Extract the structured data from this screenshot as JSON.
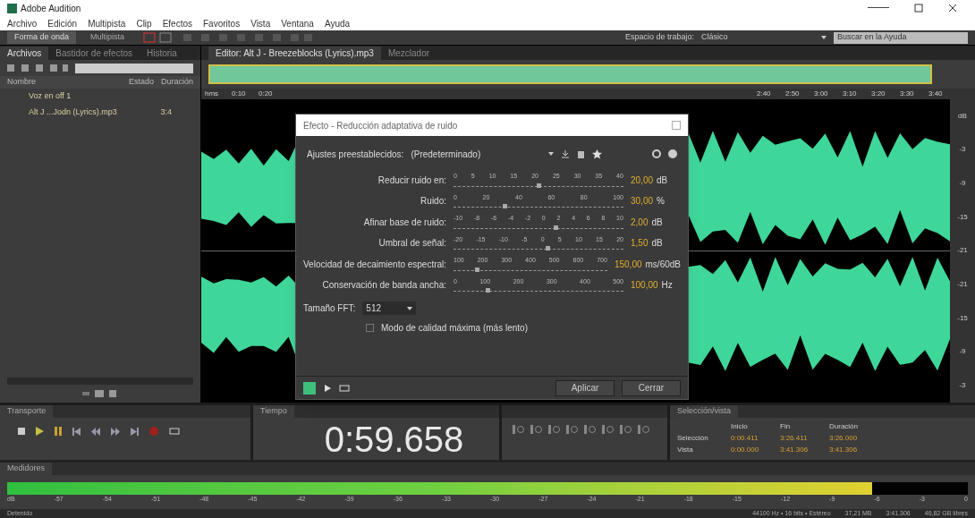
{
  "window": {
    "title": "Adobe Audition"
  },
  "menu": [
    "Archivo",
    "Edición",
    "Multipista",
    "Clip",
    "Efectos",
    "Favoritos",
    "Vista",
    "Ventana",
    "Ayuda"
  ],
  "toolbar": {
    "views": [
      {
        "label": "Forma de onda",
        "selected": true
      },
      {
        "label": "Multipista",
        "selected": false
      }
    ],
    "workspace_label": "Espacio de trabajo:",
    "workspace": "Clásico",
    "help_placeholder": "Buscar en la Ayuda"
  },
  "files_panel": {
    "tabs": [
      {
        "label": "Archivos",
        "selected": true
      },
      {
        "label": "Bastidor de efectos",
        "selected": false
      },
      {
        "label": "Historia",
        "selected": false
      }
    ],
    "columns": [
      "Nombre",
      "Estado",
      "Duración"
    ],
    "files": [
      {
        "name": "Voz en off 1"
      },
      {
        "name": "Alt J ...Jodn (Lyrics).mp3",
        "duration": "3:4"
      }
    ]
  },
  "editor": {
    "tabs": [
      {
        "label": "Editor: Alt J - Breezeblocks (Lyrics).mp3",
        "selected": true
      },
      {
        "label": "Mezclador",
        "selected": false
      }
    ],
    "ruler_left": [
      "hms",
      "0:10",
      "0:20"
    ],
    "ruler_right": [
      "2:40",
      "2:50",
      "3:00",
      "3:10",
      "3:20",
      "3:30",
      "3:40"
    ],
    "db_scale": [
      "dB",
      "-3",
      "-9",
      "-15",
      "-21",
      "-21",
      "-15",
      "-9",
      "-3"
    ]
  },
  "dialog": {
    "title": "Efecto - Reducción adaptativa de ruido",
    "preset_label": "Ajustes preestablecidos:",
    "preset": "(Predeterminado)",
    "sliders": [
      {
        "label": "Reducir ruido en:",
        "ticks": [
          "0",
          "5",
          "10",
          "15",
          "20",
          "25",
          "30",
          "35",
          "40"
        ],
        "level": 0.5,
        "value": "20,00",
        "unit": "dB"
      },
      {
        "label": "Ruido:",
        "ticks": [
          "0",
          "20",
          "40",
          "60",
          "80",
          "100"
        ],
        "level": 0.3,
        "value": "30,00",
        "unit": "%"
      },
      {
        "label": "Afinar base de ruido:",
        "ticks": [
          "-10",
          "-8",
          "-6",
          "-4",
          "-2",
          "0",
          "2",
          "4",
          "6",
          "8",
          "10"
        ],
        "level": 0.6,
        "value": "2,00",
        "unit": "dB"
      },
      {
        "label": "Umbral de señal:",
        "ticks": [
          "-20",
          "-15",
          "-10",
          "-5",
          "0",
          "5",
          "10",
          "15",
          "20"
        ],
        "level": 0.55,
        "value": "1,50",
        "unit": "dB"
      },
      {
        "label": "Velocidad de decaimiento espectral:",
        "ticks": [
          "100",
          "200",
          "300",
          "400",
          "500",
          "600",
          "700"
        ],
        "level": 0.15,
        "value": "150,00",
        "unit": "ms/60dB"
      },
      {
        "label": "Conservación de banda ancha:",
        "ticks": [
          "0",
          "100",
          "200",
          "300",
          "400",
          "500"
        ],
        "level": 0.2,
        "value": "100,00",
        "unit": "Hz"
      }
    ],
    "fft_label": "Tamaño FFT:",
    "fft": "512",
    "quality": {
      "label": "Modo de calidad máxima (más lento)",
      "checked": false
    },
    "power_on": true,
    "buttons": [
      "Aplicar",
      "Cerrar"
    ]
  },
  "transport": {
    "title": "Transporte",
    "playing": false
  },
  "time": {
    "title": "Tiempo",
    "value": "0:59.658"
  },
  "selection": {
    "title": "Selección/vista",
    "headers": [
      "Inicio",
      "Fin",
      "Duración"
    ],
    "rows": [
      {
        "label": "Selección",
        "values": [
          "0:00.411",
          "3:26.411",
          "3:26.000"
        ]
      },
      {
        "label": "Vista",
        "values": [
          "0:00.000",
          "3:41.306",
          "3:41.306"
        ]
      }
    ]
  },
  "meters": {
    "title": "Medidores",
    "level": 0.9,
    "scale": [
      "dB",
      "-57",
      "-54",
      "-51",
      "-48",
      "-45",
      "-42",
      "-39",
      "-36",
      "-33",
      "-30",
      "-27",
      "-24",
      "-21",
      "-18",
      "-15",
      "-12",
      "-9",
      "-6",
      "-3",
      "0"
    ]
  },
  "status": {
    "left": "Detenido",
    "right": [
      "44100 Hz • 16 bits • Estéreo",
      "37,21 MB",
      "3:41.306",
      "46,82 GB libres"
    ]
  }
}
